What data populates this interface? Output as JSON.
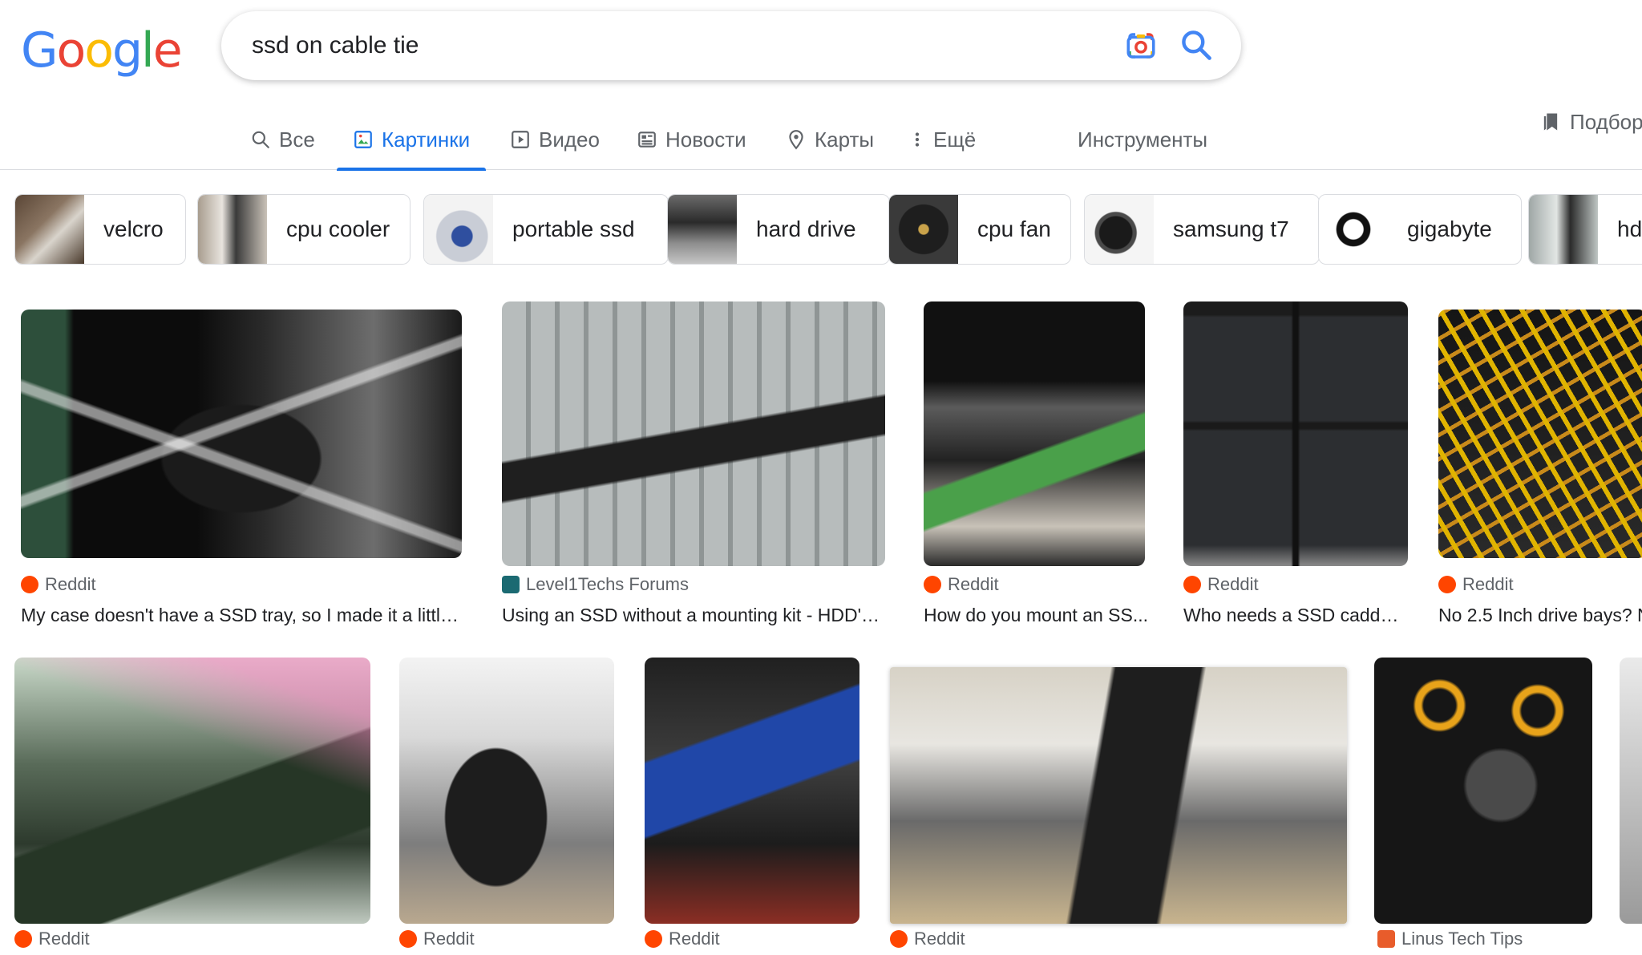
{
  "logo": {
    "letters": [
      "G",
      "o",
      "o",
      "g",
      "l",
      "e"
    ],
    "colors": [
      "#4285F4",
      "#EA4335",
      "#FBBC05",
      "#4285F4",
      "#34A853",
      "#EA4335"
    ]
  },
  "search": {
    "query": "ssd on cable tie",
    "lens_icon": "google-lens-icon",
    "search_icon": "search-icon"
  },
  "tabs": {
    "all": "Все",
    "images": "Картинки",
    "videos": "Видео",
    "news": "Новости",
    "maps": "Карты",
    "more": "Ещё",
    "tools": "Инструменты",
    "collections": "Подборки",
    "active": "images"
  },
  "chips": [
    "velcro",
    "cpu cooler",
    "portable ssd",
    "hard drive",
    "cpu fan",
    "samsung t7",
    "gigabyte",
    "hdd"
  ],
  "results_row1": [
    {
      "source": "Reddit",
      "title": "My case doesn't have a SSD tray, so I made it a little ...",
      "favicon": "reddit-icon"
    },
    {
      "source": "Level1Techs Forums",
      "title": "Using an SSD without a mounting kit - HDD's ...",
      "favicon": "level1techs-icon"
    },
    {
      "source": "Reddit",
      "title": "How do you mount an SS...",
      "favicon": "reddit-icon"
    },
    {
      "source": "Reddit",
      "title": "Who needs a SSD caddy...",
      "favicon": "reddit-icon"
    },
    {
      "source": "Reddit",
      "title": "No 2.5 Inch drive bays? N",
      "favicon": "reddit-icon"
    }
  ],
  "results_row2": [
    {
      "source": "Reddit",
      "favicon": "reddit-icon"
    },
    {
      "source": "Reddit",
      "favicon": "reddit-icon"
    },
    {
      "source": "Reddit",
      "favicon": "reddit-icon"
    },
    {
      "source": "Reddit",
      "favicon": "reddit-icon"
    },
    {
      "source": "Linus Tech Tips",
      "favicon": "linus-tech-tips-icon"
    }
  ],
  "colors": {
    "accent": "#1a73e8",
    "text": "#202124",
    "muted": "#5f6368",
    "border": "#dadce0"
  }
}
